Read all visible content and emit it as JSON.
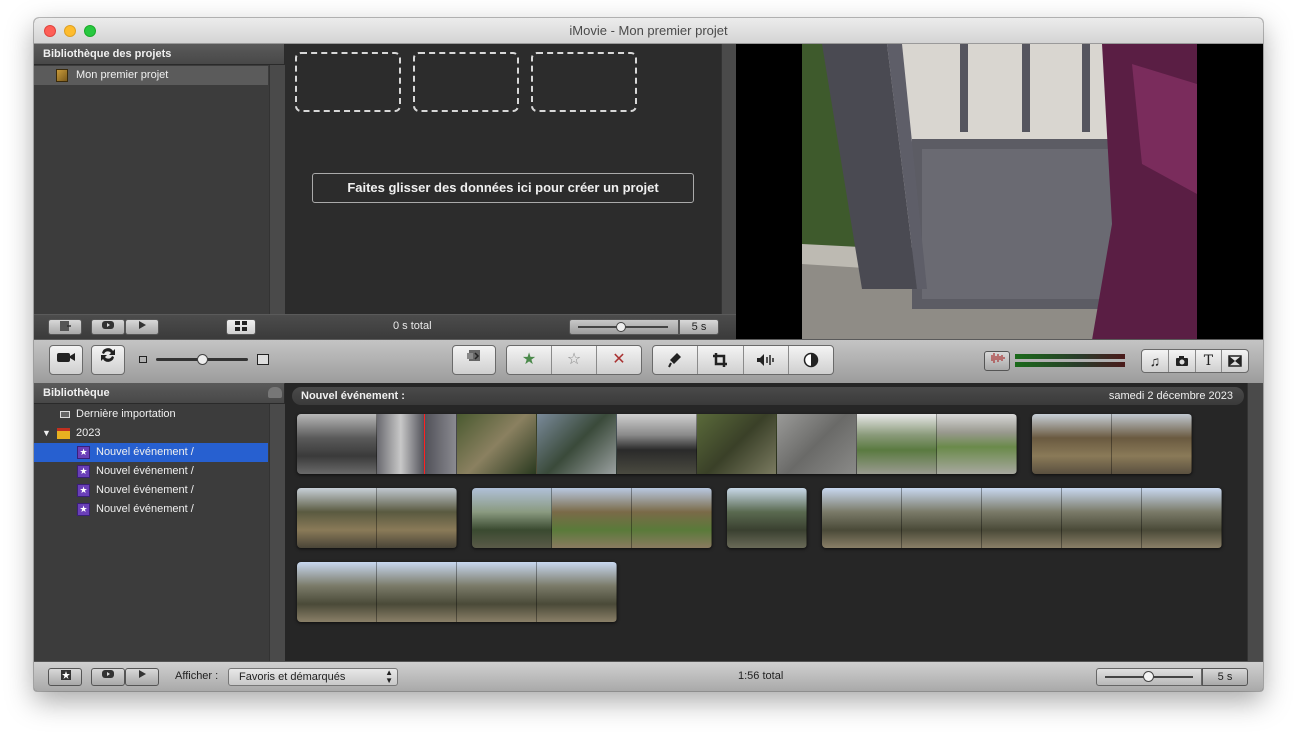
{
  "window": {
    "title": "iMovie - Mon premier projet"
  },
  "project_library": {
    "header": "Bibliothèque des projets",
    "items": [
      {
        "label": "Mon premier projet"
      }
    ],
    "total": "0 s total",
    "zoom_label": "5 s"
  },
  "project_area": {
    "drop_message": "Faites glisser des données ici pour créer un projet"
  },
  "event_library": {
    "header": "Bibliothèque",
    "last_import": "Dernière importation",
    "year": "2023",
    "events": [
      {
        "label": "Nouvel événement /",
        "selected": true
      },
      {
        "label": "Nouvel événement /",
        "selected": false
      },
      {
        "label": "Nouvel événement /",
        "selected": false
      },
      {
        "label": "Nouvel événement /",
        "selected": false
      }
    ]
  },
  "event_browser": {
    "event_title": "Nouvel événement :",
    "event_date": "samedi 2 décembre 2023"
  },
  "bottom_bar": {
    "show_label": "Afficher :",
    "filter_value": "Favoris et démarqués",
    "total": "1:56 total",
    "zoom_label": "5 s"
  },
  "colors": {
    "selection": "#2760d0",
    "favorite_badge": "#6a3fb8",
    "playhead": "#ff2020"
  }
}
